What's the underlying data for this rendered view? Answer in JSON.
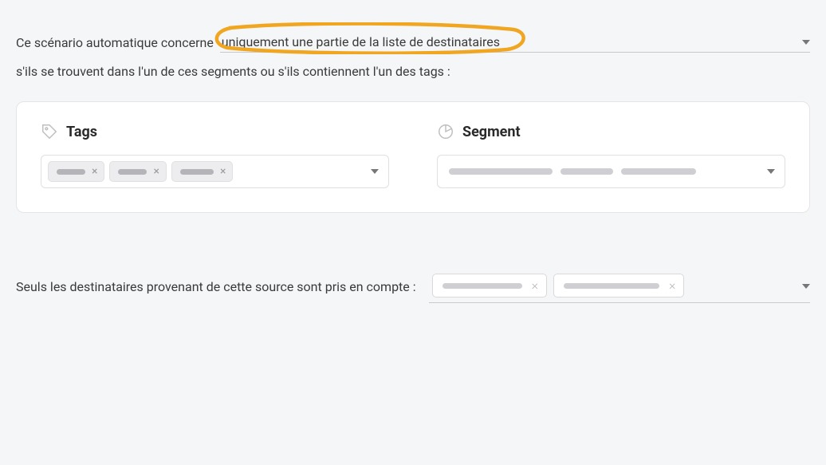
{
  "intro": {
    "prefix": "Ce scénario automatique concerne ",
    "select_value": "uniquement une partie de la liste de destinataires"
  },
  "condition_text": "s'ils se trouvent dans l'un de ces segments ou s'ils contiennent l'un des tags :",
  "panel": {
    "tags": {
      "title": "Tags",
      "count": 3
    },
    "segment": {
      "title": "Segment"
    }
  },
  "source": {
    "label": "Seuls les destinataires provenant de cette source sont pris en compte :",
    "count": 2
  }
}
